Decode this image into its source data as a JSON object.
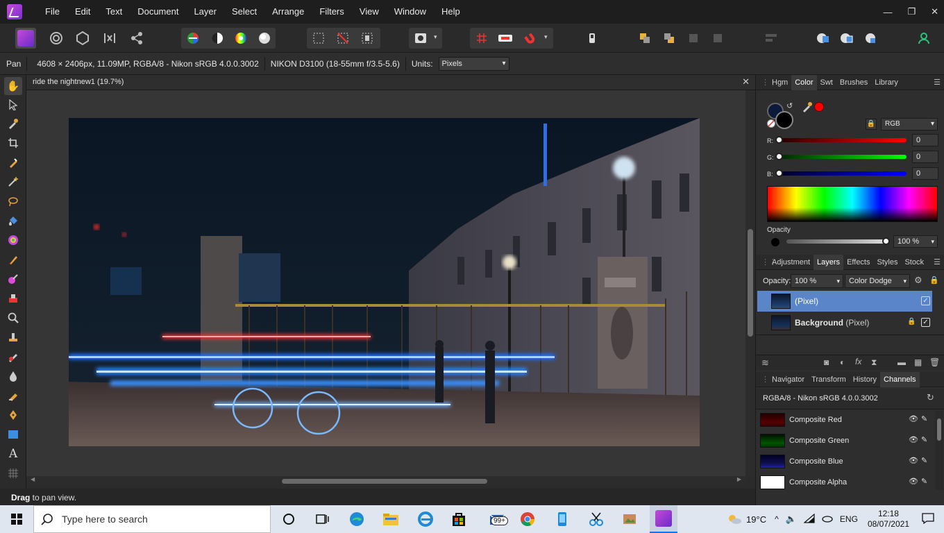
{
  "menu": [
    "File",
    "Edit",
    "Text",
    "Document",
    "Layer",
    "Select",
    "Arrange",
    "Filters",
    "View",
    "Window",
    "Help"
  ],
  "context": {
    "tool": "Pan",
    "image_info": "4608 × 2406px, 11.09MP, RGBA/8 - Nikon sRGB 4.0.0.3002",
    "camera": "NIKON D3100 (18-55mm f/3.5-5.6)",
    "units_label": "Units:",
    "units_value": "Pixels"
  },
  "document": {
    "title": "ride the nightnew1 (19.7%)"
  },
  "status": {
    "bold": "Drag",
    "text": " to pan view."
  },
  "color_panel": {
    "tabs": [
      "Hgm",
      "Color",
      "Swt",
      "Brushes",
      "Library"
    ],
    "selected_tab": "Color",
    "model": "RGB",
    "r_label": "R:",
    "g_label": "G:",
    "b_label": "B:",
    "r": "0",
    "g": "0",
    "b": "0",
    "opacity_label": "Opacity",
    "opacity_value": "100 %",
    "fill_color": "#0b1a3a",
    "stroke_color": "#000000",
    "picker_color": "#ff0000"
  },
  "layers_panel": {
    "tabs": [
      "Adjustment",
      "Layers",
      "Effects",
      "Styles",
      "Stock"
    ],
    "selected_tab": "Layers",
    "opacity_label": "Opacity:",
    "opacity_value": "100 %",
    "blend_mode": "Color Dodge",
    "layers": [
      {
        "name": "",
        "type": "(Pixel)",
        "selected": true
      },
      {
        "name": "Background",
        "type": " (Pixel)",
        "selected": false
      }
    ]
  },
  "channels_panel": {
    "tabs": [
      "Navigator",
      "Transform",
      "History",
      "Channels"
    ],
    "selected_tab": "Channels",
    "profile": "RGBA/8 - Nikon sRGB 4.0.0.3002",
    "channels": [
      "Composite Red",
      "Composite Green",
      "Composite Blue",
      "Composite Alpha"
    ]
  },
  "taskbar": {
    "search_placeholder": "Type here to search",
    "mail_badge": "99+",
    "weather": "19°C",
    "language": "ENG",
    "time": "12:18",
    "date": "08/07/2021"
  }
}
